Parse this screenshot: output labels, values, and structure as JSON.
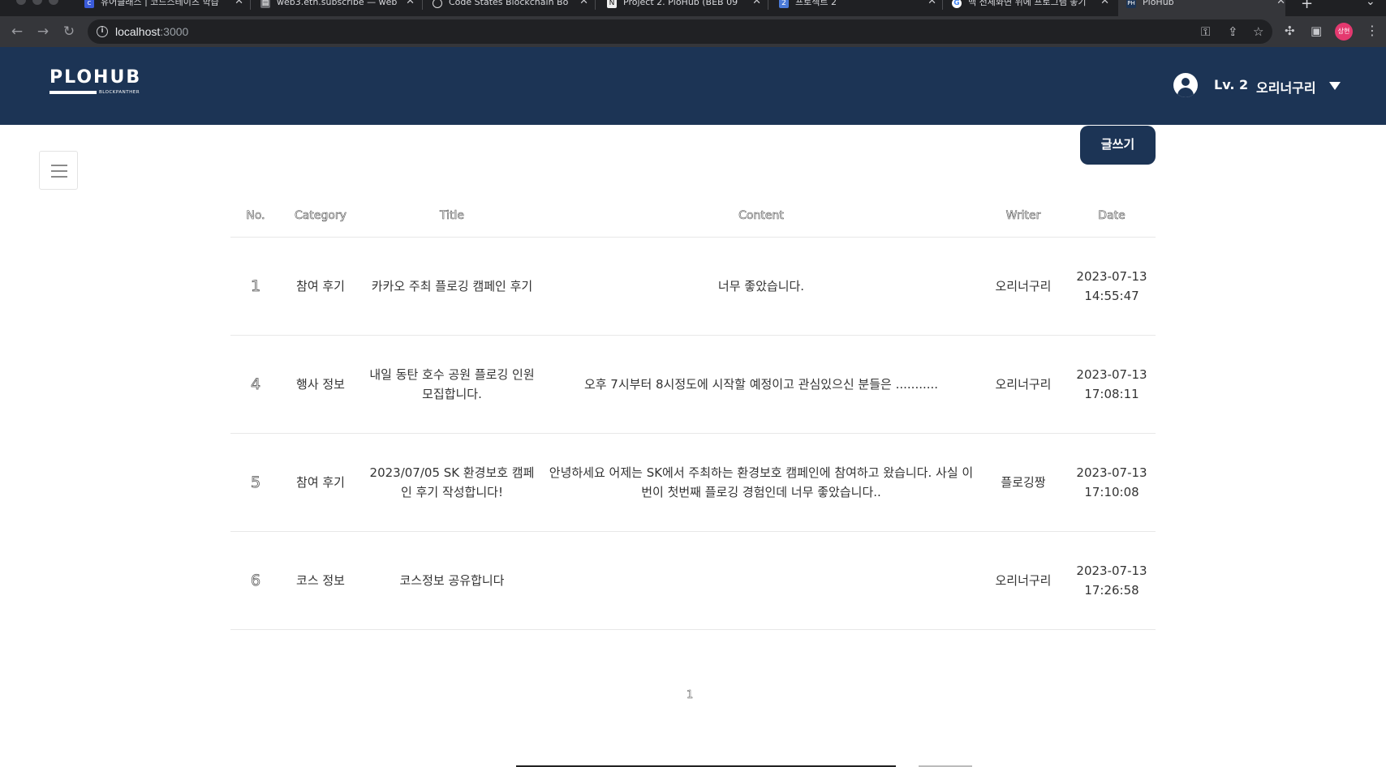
{
  "browser": {
    "tabs": [
      {
        "title": "유어클래스 | 코드스테이츠 학습",
        "active": false
      },
      {
        "title": "web3.eth.subscribe — web",
        "active": false
      },
      {
        "title": "Code States Blockchain Bo",
        "active": false
      },
      {
        "title": "Project 2. PloHub (BEB 09",
        "active": false
      },
      {
        "title": "프로젝트 2",
        "active": false
      },
      {
        "title": "맥 전체화면 위에 프로그램 놓기",
        "active": false
      },
      {
        "title": "PloHub",
        "active": true
      }
    ],
    "url_host": "localhost",
    "url_port": ":3000",
    "profile_initials": "상현"
  },
  "header": {
    "logo": "PLOHUB",
    "logo_sub": "BLOCKPANTHER",
    "level": "Lv. 2",
    "username": "오리너구리"
  },
  "actions": {
    "write_label": "글쓰기"
  },
  "table": {
    "columns": [
      "No.",
      "Category",
      "Title",
      "Content",
      "Writer",
      "Date"
    ],
    "rows": [
      {
        "no": "1",
        "category": "참여 후기",
        "title": "카카오 주최 플로깅 캠페인 후기",
        "content": "너무 좋았습니다.",
        "writer": "오리너구리",
        "date": "2023-07-13 14:55:47"
      },
      {
        "no": "4",
        "category": "행사 정보",
        "title": "내일 동탄 호수 공원 플로깅 인원 모집합니다.",
        "content": "오후 7시부터 8시정도에 시작할 예정이고 관심있으신 분들은 ...........",
        "writer": "오리너구리",
        "date": "2023-07-13 17:08:11"
      },
      {
        "no": "5",
        "category": "참여 후기",
        "title": "2023/07/05 SK 환경보호 캠페인 후기 작성합니다!",
        "content": "안녕하세요 어제는 SK에서 주최하는 환경보호 캠페인에 참여하고 왔습니다. 사실 이번이 첫번째 플로깅 경험인데 너무 좋았습니다..",
        "writer": "플로깅짱",
        "date": "2023-07-13 17:10:08"
      },
      {
        "no": "6",
        "category": "코스 정보",
        "title": "코스정보 공유합니다",
        "content": "",
        "writer": "오리너구리",
        "date": "2023-07-13 17:26:58"
      }
    ]
  },
  "pagination": {
    "current": "1"
  }
}
